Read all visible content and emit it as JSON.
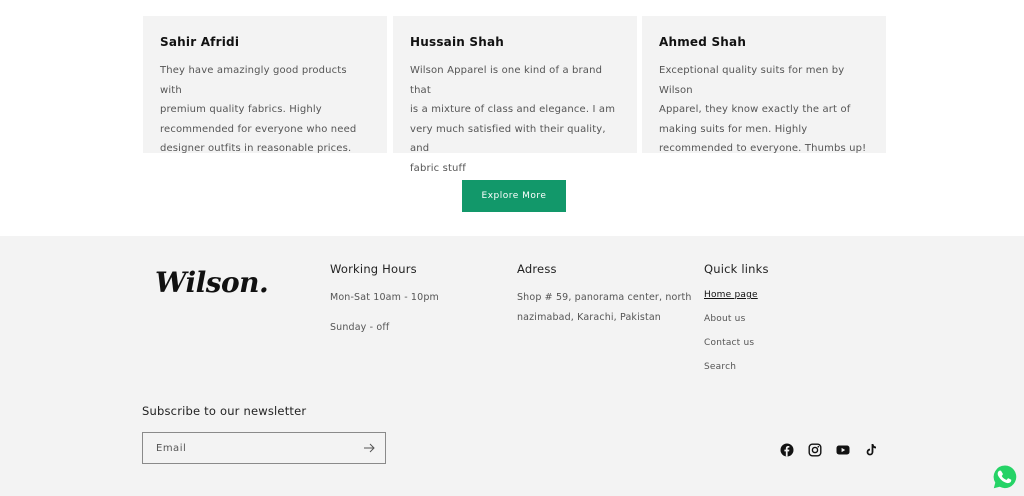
{
  "testimonials": [
    {
      "name": "Sahir Afridi",
      "lines": [
        "They have amazingly good products with",
        "premium quality fabrics. Highly",
        "recommended for everyone who need",
        "designer outfits in reasonable prices."
      ]
    },
    {
      "name": "Hussain Shah",
      "lines": [
        "Wilson Apparel is one kind of a brand that",
        "is a mixture of class and elegance. I am",
        "very much satisfied with their quality, and",
        "fabric stuff"
      ]
    },
    {
      "name": "Ahmed Shah",
      "lines": [
        "Exceptional quality suits for men by Wilson",
        "Apparel, they know exactly the art of",
        "making suits for men. Highly",
        "recommended to everyone. Thumbs up!"
      ]
    }
  ],
  "explore_button": "Explore More",
  "footer": {
    "logo_text": "Wilson.",
    "hours": {
      "title": "Working Hours",
      "lines": [
        "Mon-Sat 10am - 10pm",
        "Sunday - off"
      ]
    },
    "address": {
      "title": "Adress",
      "lines": [
        "Shop # 59, panorama center, north",
        "nazimabad, Karachi, Pakistan"
      ]
    },
    "links": {
      "title": "Quick links",
      "items": [
        "Home page",
        "About us",
        "Contact us",
        "Search"
      ]
    },
    "newsletter": {
      "title": "Subscribe to our newsletter",
      "placeholder": "Email"
    },
    "socials": [
      "facebook-icon",
      "instagram-icon",
      "youtube-icon",
      "tiktok-icon"
    ]
  },
  "colors": {
    "accent": "#12986a",
    "card_bg": "#f3f3f3",
    "whatsapp": "#25d366"
  }
}
